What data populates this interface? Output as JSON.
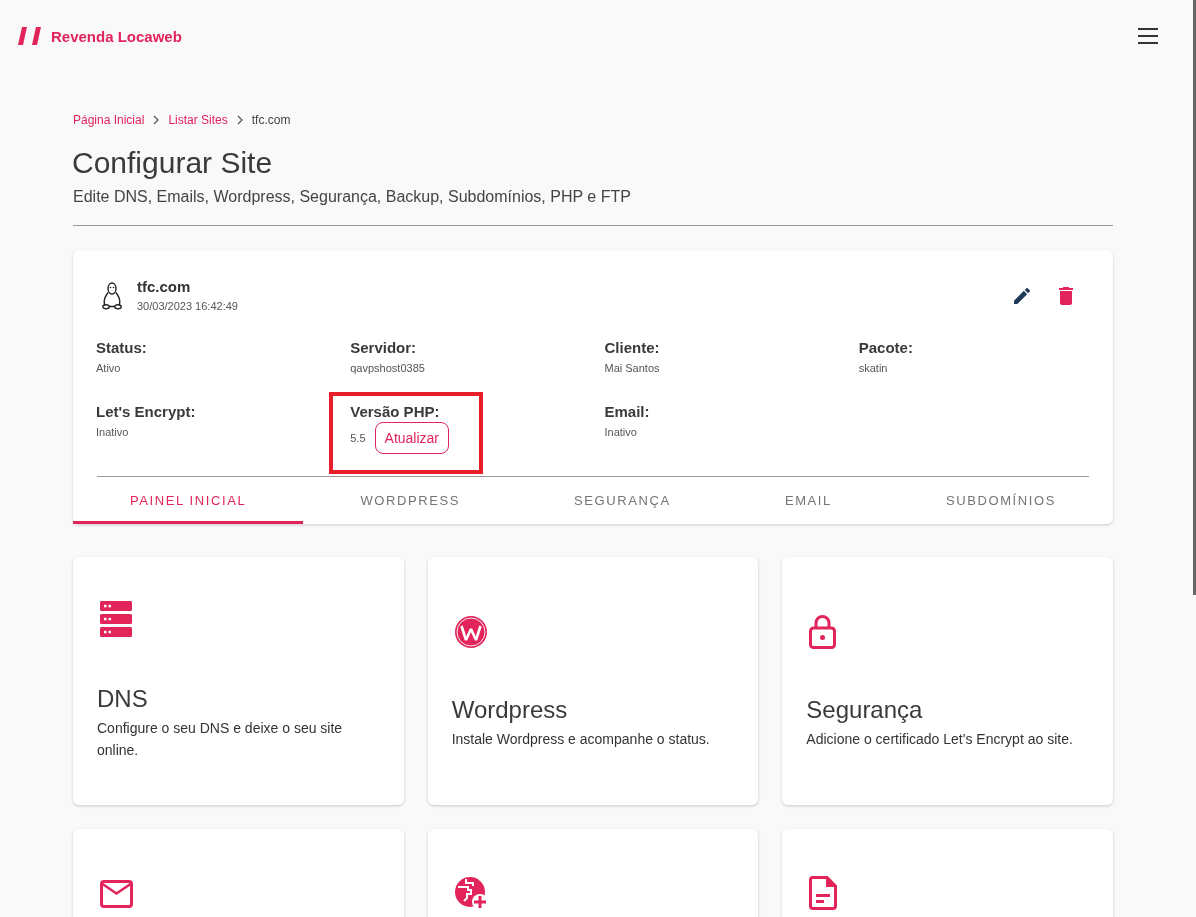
{
  "header": {
    "brand": "Revenda Locaweb"
  },
  "breadcrumb": [
    {
      "label": "Página Inicial",
      "kind": "link"
    },
    {
      "label": "Listar Sites",
      "kind": "link"
    },
    {
      "label": "tfc.com",
      "kind": "current"
    }
  ],
  "page": {
    "title": "Configurar Site",
    "subtitle": "Edite DNS, Emails, Wordpress, Segurança, Backup, Subdomínios, PHP e FTP"
  },
  "site": {
    "name": "tfc.com",
    "created": "30/03/2023 16:42:49",
    "fields": [
      {
        "label": "Status:",
        "value": "Ativo",
        "highlighted": false
      },
      {
        "label": "Servidor:",
        "value": "qavpshost0385",
        "highlighted": false
      },
      {
        "label": "Cliente:",
        "value": "Mai Santos",
        "highlighted": false
      },
      {
        "label": "Pacote:",
        "value": "skatin",
        "highlighted": false
      },
      {
        "label": "Let's Encrypt:",
        "value": "Inativo",
        "highlighted": false
      },
      {
        "label": "Versão PHP:",
        "value": "5.5",
        "action": "Atualizar",
        "highlighted": true
      },
      {
        "label": "Email:",
        "value": "Inativo",
        "highlighted": false
      }
    ]
  },
  "tabs": [
    {
      "label": "PAINEL INICIAL",
      "selected": true
    },
    {
      "label": "WORDPRESS",
      "selected": false
    },
    {
      "label": "SEGURANÇA",
      "selected": false
    },
    {
      "label": "EMAIL",
      "selected": false
    },
    {
      "label": "SUBDOMÍNIOS",
      "selected": false
    }
  ],
  "cards": [
    {
      "kind": "server",
      "title": "DNS",
      "description": "Configure o seu DNS e deixe o seu site online."
    },
    {
      "kind": "wordpress",
      "title": "Wordpress",
      "description": "Instale Wordpress e acompanhe o status."
    },
    {
      "kind": "lock",
      "title": "Segurança",
      "description": "Adicione o certificado Let's Encrypt ao site."
    },
    {
      "kind": "mail"
    },
    {
      "kind": "globe"
    },
    {
      "kind": "document"
    }
  ]
}
